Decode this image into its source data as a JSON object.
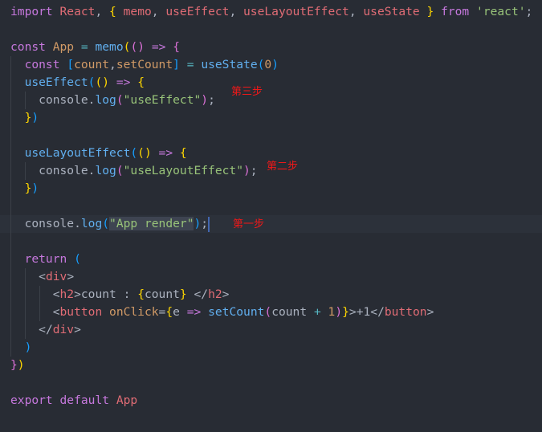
{
  "editor": {
    "lines": [
      [
        [
          "import",
          "k"
        ],
        [
          " ",
          "p"
        ],
        [
          "React",
          "v"
        ],
        [
          ", ",
          "p"
        ],
        [
          "{",
          "y"
        ],
        [
          " ",
          "p"
        ],
        [
          "memo",
          "v"
        ],
        [
          ", ",
          "p"
        ],
        [
          "useEffect",
          "v"
        ],
        [
          ", ",
          "p"
        ],
        [
          "useLayoutEffect",
          "v"
        ],
        [
          ", ",
          "p"
        ],
        [
          "useState",
          "v"
        ],
        [
          " ",
          "p"
        ],
        [
          "}",
          "y"
        ],
        [
          " ",
          "p"
        ],
        [
          "from",
          "k"
        ],
        [
          " ",
          "p"
        ],
        [
          "'react'",
          "s"
        ],
        [
          ";",
          "p"
        ]
      ],
      [],
      [
        [
          "const",
          "k"
        ],
        [
          " ",
          "p"
        ],
        [
          "App",
          "a"
        ],
        [
          " ",
          "p"
        ],
        [
          "=",
          "o"
        ],
        [
          " ",
          "p"
        ],
        [
          "memo",
          "f"
        ],
        [
          "(",
          "y"
        ],
        [
          "()",
          "m"
        ],
        [
          " ",
          "p"
        ],
        [
          "=>",
          "k"
        ],
        [
          " ",
          "p"
        ],
        [
          "{",
          "m"
        ]
      ],
      [
        [
          "  ",
          "p"
        ],
        [
          "const",
          "k"
        ],
        [
          " ",
          "p"
        ],
        [
          "[",
          "b"
        ],
        [
          "count",
          "a"
        ],
        [
          ",",
          "p"
        ],
        [
          "setCount",
          "a"
        ],
        [
          "]",
          "b"
        ],
        [
          " ",
          "p"
        ],
        [
          "=",
          "o"
        ],
        [
          " ",
          "p"
        ],
        [
          "useState",
          "f"
        ],
        [
          "(",
          "b"
        ],
        [
          "0",
          "a"
        ],
        [
          ")",
          "b"
        ]
      ],
      [
        [
          "  ",
          "p"
        ],
        [
          "useEffect",
          "f"
        ],
        [
          "(",
          "b"
        ],
        [
          "()",
          "y"
        ],
        [
          " ",
          "p"
        ],
        [
          "=>",
          "k"
        ],
        [
          " ",
          "p"
        ],
        [
          "{",
          "y"
        ]
      ],
      [
        [
          "    ",
          "p"
        ],
        [
          "console",
          "p"
        ],
        [
          ".",
          "p"
        ],
        [
          "log",
          "f"
        ],
        [
          "(",
          "m"
        ],
        [
          "\"useEffect\"",
          "s"
        ],
        [
          ")",
          "m"
        ],
        [
          ";",
          "p"
        ]
      ],
      [
        [
          "  ",
          "p"
        ],
        [
          "}",
          "y"
        ],
        [
          ")",
          "b"
        ]
      ],
      [],
      [
        [
          "  ",
          "p"
        ],
        [
          "useLayoutEffect",
          "f"
        ],
        [
          "(",
          "b"
        ],
        [
          "()",
          "y"
        ],
        [
          " ",
          "p"
        ],
        [
          "=>",
          "k"
        ],
        [
          " ",
          "p"
        ],
        [
          "{",
          "y"
        ]
      ],
      [
        [
          "    ",
          "p"
        ],
        [
          "console",
          "p"
        ],
        [
          ".",
          "p"
        ],
        [
          "log",
          "f"
        ],
        [
          "(",
          "m"
        ],
        [
          "\"useLayoutEffect\"",
          "s"
        ],
        [
          ")",
          "m"
        ],
        [
          ";",
          "p"
        ]
      ],
      [
        [
          "  ",
          "p"
        ],
        [
          "}",
          "y"
        ],
        [
          ")",
          "b"
        ]
      ],
      [],
      [
        [
          "  ",
          "p"
        ],
        [
          "console",
          "p"
        ],
        [
          ".",
          "p"
        ],
        [
          "log",
          "f"
        ],
        [
          "(",
          "b"
        ],
        [
          "\"App render\"",
          "s sel"
        ],
        [
          ")",
          "b"
        ],
        [
          ";",
          "p"
        ]
      ],
      [],
      [
        [
          "  ",
          "p"
        ],
        [
          "return",
          "k"
        ],
        [
          " ",
          "p"
        ],
        [
          "(",
          "b"
        ]
      ],
      [
        [
          "    ",
          "p"
        ],
        [
          "<",
          "p"
        ],
        [
          "div",
          "t"
        ],
        [
          ">",
          "p"
        ]
      ],
      [
        [
          "      ",
          "p"
        ],
        [
          "<",
          "p"
        ],
        [
          "h2",
          "t"
        ],
        [
          ">",
          "p"
        ],
        [
          "count : ",
          "p"
        ],
        [
          "{",
          "y"
        ],
        [
          "count",
          "p"
        ],
        [
          "}",
          "y"
        ],
        [
          " ",
          "p"
        ],
        [
          "</",
          "p"
        ],
        [
          "h2",
          "t"
        ],
        [
          ">",
          "p"
        ]
      ],
      [
        [
          "      ",
          "p"
        ],
        [
          "<",
          "p"
        ],
        [
          "button",
          "t"
        ],
        [
          " ",
          "p"
        ],
        [
          "onClick",
          "a"
        ],
        [
          "=",
          "p"
        ],
        [
          "{",
          "y"
        ],
        [
          "e",
          "g"
        ],
        [
          " ",
          "p"
        ],
        [
          "=>",
          "k"
        ],
        [
          " ",
          "p"
        ],
        [
          "setCount",
          "f"
        ],
        [
          "(",
          "m"
        ],
        [
          "count",
          "p"
        ],
        [
          " ",
          "p"
        ],
        [
          "+",
          "o"
        ],
        [
          " ",
          "p"
        ],
        [
          "1",
          "a"
        ],
        [
          ")",
          "m"
        ],
        [
          "}",
          "y"
        ],
        [
          ">+1",
          "p"
        ],
        [
          "</",
          "p"
        ],
        [
          "button",
          "t"
        ],
        [
          ">",
          "p"
        ]
      ],
      [
        [
          "    ",
          "p"
        ],
        [
          "</",
          "p"
        ],
        [
          "div",
          "t"
        ],
        [
          ">",
          "p"
        ]
      ],
      [
        [
          "  ",
          "p"
        ],
        [
          ")",
          "b"
        ]
      ],
      [
        [
          "}",
          "m"
        ],
        [
          ")",
          "y"
        ]
      ],
      [],
      [
        [
          "export",
          "k"
        ],
        [
          " ",
          "p"
        ],
        [
          "default",
          "k"
        ],
        [
          " ",
          "p"
        ],
        [
          "App",
          "v"
        ]
      ]
    ],
    "current_line": 12
  },
  "annotations": {
    "step3": "第三步",
    "step2": "第二步",
    "step1": "第一步"
  }
}
